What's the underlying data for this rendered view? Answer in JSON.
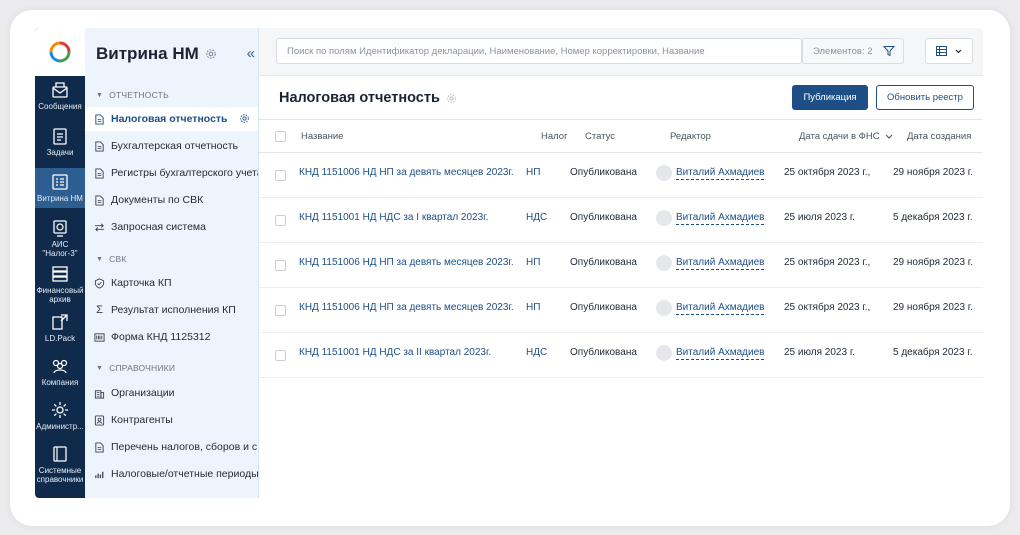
{
  "rail": {
    "items": [
      {
        "label": "Сообщения",
        "icon": "mail-icon"
      },
      {
        "label": "Задачи",
        "icon": "clipboard-icon"
      },
      {
        "label": "Витрина НМ",
        "icon": "list-icon"
      },
      {
        "label": "АИС \"Налог-3\"",
        "icon": "globe-icon"
      },
      {
        "label": "Финансовый архив",
        "icon": "archive-icon"
      },
      {
        "label": "LD.Pack",
        "icon": "pack-icon"
      },
      {
        "label": "Компания",
        "icon": "people-icon"
      },
      {
        "label": "Администр...",
        "icon": "gear-icon"
      },
      {
        "label": "Системные справочники",
        "icon": "book-icon"
      }
    ]
  },
  "sidebar": {
    "title": "Витрина НМ",
    "collapse_glyph": "«",
    "sections": [
      {
        "label": "ОТЧЕТНОСТЬ"
      },
      {
        "label": "СВК"
      },
      {
        "label": "СПРАВОЧНИКИ"
      }
    ],
    "items": [
      {
        "label": "Налоговая отчетность",
        "icon": "document-icon"
      },
      {
        "label": "Бухгалтерская отчетность",
        "icon": "document-icon"
      },
      {
        "label": "Регистры бухгалтерского учета",
        "icon": "document-icon"
      },
      {
        "label": "Документы по СВК",
        "icon": "document-icon"
      },
      {
        "label": "Запросная система",
        "icon": "arrows-icon"
      },
      {
        "label": "Карточка КП",
        "icon": "shield-icon"
      },
      {
        "label": "Результат исполнения КП",
        "icon": "sigma-icon"
      },
      {
        "label": "Форма КНД 1125312",
        "icon": "barcode-icon"
      },
      {
        "label": "Организации",
        "icon": "building-icon"
      },
      {
        "label": "Контрагенты",
        "icon": "contact-icon"
      },
      {
        "label": "Перечень налогов, сборов и с...",
        "icon": "document-icon"
      },
      {
        "label": "Налоговые/отчетные периоды",
        "icon": "chart-icon"
      }
    ]
  },
  "topbar": {
    "search_placeholder": "Поиск по полям Идентификатор декларации, Наименование, Номер корректировки, Название",
    "count_label": "Элементов: 2"
  },
  "page": {
    "title": "Налоговая отчетность",
    "publish_label": "Публикация",
    "refresh_label": "Обновить реестр"
  },
  "table": {
    "columns": {
      "name": "Название",
      "tax": "Налог",
      "status": "Статус",
      "editor": "Редактор",
      "submitted": "Дата сдачи в ФНС",
      "created": "Дата создания"
    },
    "rows": [
      {
        "name": "КНД 1151006 НД НП за девять месяцев 2023г.",
        "tax": "НП",
        "status": "Опубликована",
        "editor": "Виталий Ахмадиев",
        "submitted": "25 октября 2023 г.,",
        "created": "29 ноября 2023 г."
      },
      {
        "name": "КНД 1151001 НД НДС за I квартал 2023г.",
        "tax": "НДС",
        "status": "Опубликована",
        "editor": "Виталий Ахмадиев",
        "submitted": "25 июля 2023 г.",
        "created": "5 декабря 2023 г."
      },
      {
        "name": "КНД 1151006 НД НП за девять месяцев 2023г.",
        "tax": "НП",
        "status": "Опубликована",
        "editor": "Виталий Ахмадиев",
        "submitted": "25 октября 2023 г.,",
        "created": "29 ноября 2023 г."
      },
      {
        "name": "КНД 1151006 НД НП за девять месяцев 2023г.",
        "tax": "НП",
        "status": "Опубликована",
        "editor": "Виталий Ахмадиев",
        "submitted": "25 октября 2023 г.,",
        "created": "29 ноября 2023 г."
      },
      {
        "name": "КНД 1151001 НД НДС за II квартал 2023г.",
        "tax": "НДС",
        "status": "Опубликована",
        "editor": "Виталий Ахмадиев",
        "submitted": "25 июля 2023 г.",
        "created": "5 декабря 2023 г."
      }
    ]
  },
  "colors": {
    "rail_bg": "#0f2a4a",
    "rail_active": "#2d5e92",
    "accent": "#1d4f86",
    "sidebar_bg": "#eef4fb"
  }
}
